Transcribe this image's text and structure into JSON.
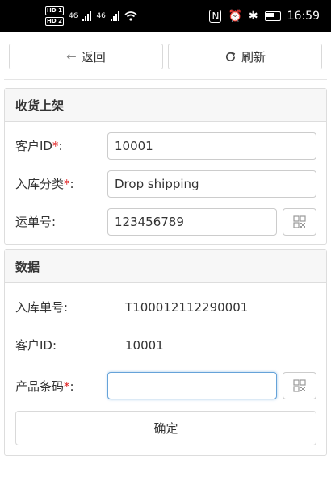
{
  "statusbar": {
    "time": "16:59",
    "network1": "46",
    "network2": "46"
  },
  "toolbar": {
    "back_label": "返回",
    "refresh_label": "刷新"
  },
  "panel1": {
    "title": "收货上架",
    "customer_id": {
      "label": "客户ID",
      "value": "10001"
    },
    "category": {
      "label": "入库分类",
      "value": "Drop shipping"
    },
    "waybill": {
      "label": "运单号",
      "value": "123456789"
    }
  },
  "panel2": {
    "title": "数据",
    "inbound_no": {
      "label": "入库单号:",
      "value": "T100012112290001"
    },
    "customer_id": {
      "label": "客户ID:",
      "value": "10001"
    },
    "barcode": {
      "label": "产品条码",
      "value": ""
    },
    "confirm_label": "确定"
  },
  "colors": {
    "required": "#e02020",
    "focus": "#66a3d9",
    "panel_head": "#f7f7f7"
  }
}
